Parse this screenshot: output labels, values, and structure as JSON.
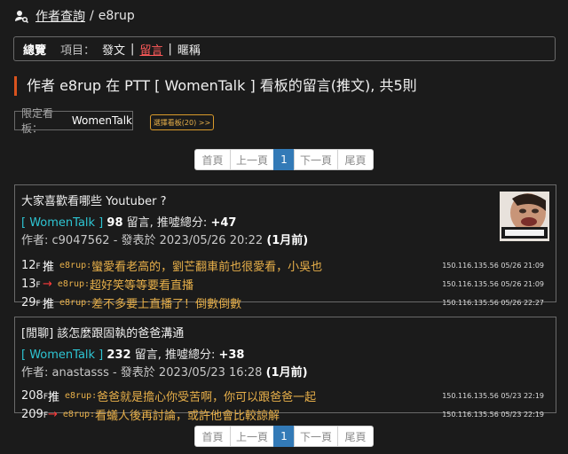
{
  "breadcrumb": {
    "link": "作者查詢",
    "sep": "/",
    "current": "e8rup"
  },
  "tabs": {
    "overview": "總覽",
    "label": "項目：",
    "items": [
      {
        "label": "發文",
        "active": false
      },
      {
        "label": "留言",
        "active": true
      },
      {
        "label": "暱稱",
        "active": false
      }
    ],
    "sep": "|"
  },
  "heading": "作者 e8rup 在 PTT [ WomenTalk ] 看板的留言(推文), 共5則",
  "filter": {
    "label": "限定看板：",
    "value": "WomenTalk",
    "button": "選擇看板(20) >>"
  },
  "pager": [
    "首頁",
    "上一頁",
    "1",
    "下一頁",
    "尾頁"
  ],
  "posts": [
    {
      "title": "大家喜歡看哪些 Youtuber ?",
      "board": "[ WomenTalk ]",
      "comments": "98",
      "comments_label": "留言, 推噓總分:",
      "score": "+47",
      "author_line": "作者: c9047562 - 發表於 2023/05/26 20:22",
      "tz": "(1月前)",
      "thumb_icon": "youtuber-thumbnail-image",
      "pushes": [
        {
          "floor": "12",
          "tag": "推",
          "type": "push",
          "uid": "e8rup",
          "content": "蠻愛看老高的，劉芒翻車前也很愛看，小吳也",
          "ipdt": "150.116.135.56 05/26 21:09"
        },
        {
          "floor": "13",
          "tag": "→",
          "type": "arrow",
          "uid": "e8rup",
          "content": "超好笑等等要看直播",
          "ipdt": "150.116.135.56 05/26 21:09"
        },
        {
          "floor": "29",
          "tag": "推",
          "type": "push",
          "uid": "e8rup",
          "content": "差不多要上直播了！倒數倒數",
          "ipdt": "150.116.135.56 05/26 22:27"
        }
      ]
    },
    {
      "title": "[閒聊] 該怎麼跟固執的爸爸溝通",
      "board": "[ WomenTalk ]",
      "comments": "232",
      "comments_label": "留言, 推噓總分:",
      "score": "+38",
      "author_line": "作者: anastasss - 發表於 2023/05/23 16:28",
      "tz": "(1月前)",
      "pushes": [
        {
          "floor": "208",
          "tag": "推",
          "type": "push",
          "uid": "e8rup",
          "content": "爸爸就是擔心你受苦啊，你可以跟爸爸一起",
          "ipdt": "150.116.135.56 05/23 22:19"
        },
        {
          "floor": "209",
          "tag": "→",
          "type": "arrow",
          "uid": "e8rup",
          "content": "看蟻人後再討論，或許他會比較諒解",
          "ipdt": "150.116.135.56 05/23 22:19"
        }
      ]
    }
  ],
  "floor_suffix": "F",
  "uid_suffix": ":",
  "colors": {
    "accent": "#d9531e",
    "board": "#2ec5d3",
    "push_text": "#e8b04a",
    "arrow": "#ff3b3b",
    "pager_active": "#337ab7"
  }
}
